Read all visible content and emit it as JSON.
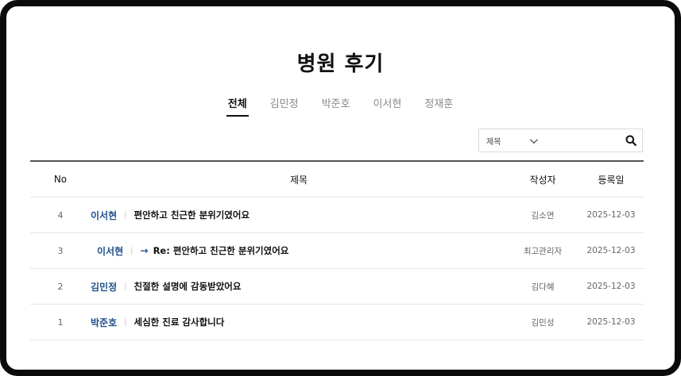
{
  "page": {
    "title": "병원 후기"
  },
  "tabs": [
    {
      "label": "전체",
      "active": true
    },
    {
      "label": "김민정",
      "active": false
    },
    {
      "label": "박준호",
      "active": false
    },
    {
      "label": "이서현",
      "active": false
    },
    {
      "label": "정재훈",
      "active": false
    }
  ],
  "search": {
    "select_value": "제목",
    "input_value": "",
    "placeholder": ""
  },
  "table": {
    "headers": {
      "no": "No",
      "title": "제목",
      "author": "작성자",
      "date": "등록일"
    },
    "rows": [
      {
        "no": "4",
        "doctor": "이서현",
        "title": "편안하고 친근한 분위기였어요",
        "author": "김소연",
        "date": "2025-12-03",
        "reply": false
      },
      {
        "no": "3",
        "doctor": "이서현",
        "title": "Re: 편안하고 친근한 분위기였어요",
        "author": "최고관리자",
        "date": "2025-12-03",
        "reply": true
      },
      {
        "no": "2",
        "doctor": "김민정",
        "title": "친절한 설명에 감동받았어요",
        "author": "김다혜",
        "date": "2025-12-03",
        "reply": false
      },
      {
        "no": "1",
        "doctor": "박준호",
        "title": "세심한 진료 감사합니다",
        "author": "김민성",
        "date": "2025-12-03",
        "reply": false
      }
    ]
  },
  "colors": {
    "doctor_link": "#1f4f8b",
    "frame": "#0b0b0b",
    "header_rule": "#555555"
  },
  "icons": {
    "search": "search-icon",
    "dropdown": "chevron-down-icon",
    "reply": "reply-arrow-icon"
  }
}
